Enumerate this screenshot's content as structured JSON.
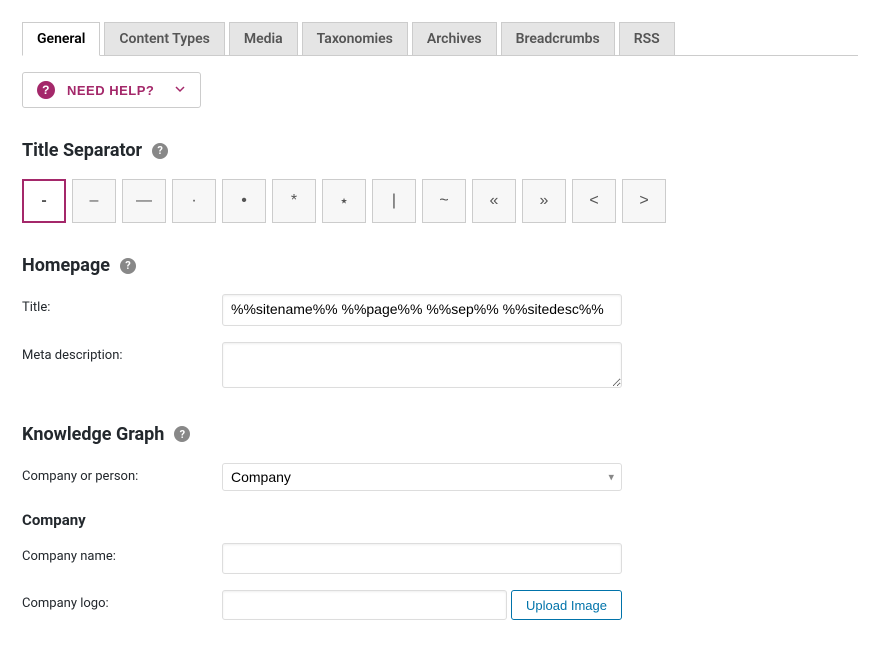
{
  "tabs": {
    "items": [
      {
        "label": "General",
        "active": true
      },
      {
        "label": "Content Types",
        "active": false
      },
      {
        "label": "Media",
        "active": false
      },
      {
        "label": "Taxonomies",
        "active": false
      },
      {
        "label": "Archives",
        "active": false
      },
      {
        "label": "Breadcrumbs",
        "active": false
      },
      {
        "label": "RSS",
        "active": false
      }
    ]
  },
  "help": {
    "label": "NEED HELP?"
  },
  "title_separator": {
    "heading": "Title Separator",
    "options": [
      "-",
      "–",
      "—",
      "·",
      "•",
      "*",
      "⋆",
      "|",
      "~",
      "«",
      "»",
      "<",
      ">"
    ],
    "selected": "-"
  },
  "homepage": {
    "heading": "Homepage",
    "title_label": "Title:",
    "title_value": "%%sitename%% %%page%% %%sep%% %%sitedesc%%",
    "meta_label": "Meta description:",
    "meta_value": ""
  },
  "knowledge_graph": {
    "heading": "Knowledge Graph",
    "type_label": "Company or person:",
    "type_value": "Company",
    "company_subheading": "Company",
    "company_name_label": "Company name:",
    "company_name_value": "",
    "company_logo_label": "Company logo:",
    "company_logo_value": "",
    "upload_label": "Upload Image"
  }
}
